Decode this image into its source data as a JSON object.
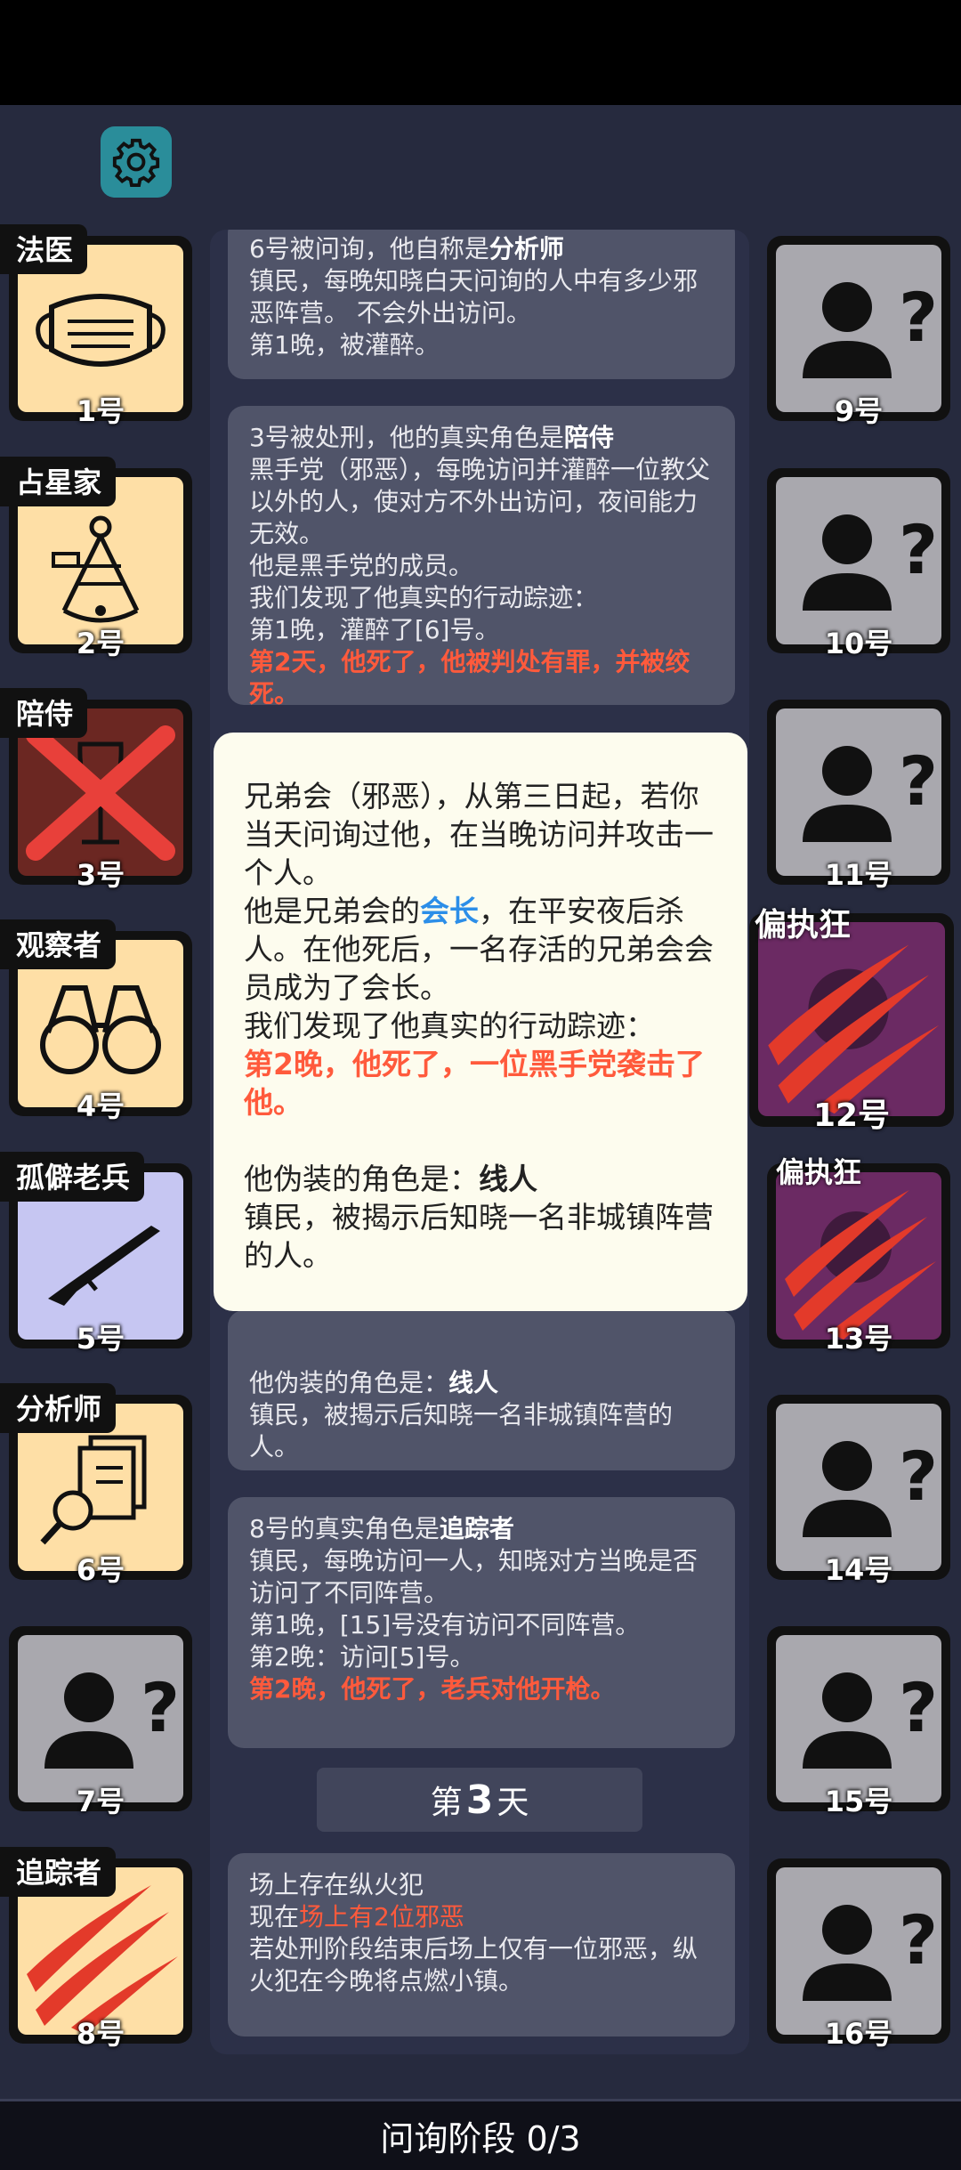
{
  "settings_icon": "gear-icon",
  "log": {
    "card1": {
      "l1": "6号被问询，他自称是",
      "l1b": "分析师",
      "l2": "镇民，每晚知晓白天问询的人中有多少邪恶阵营。 不会外出访问。",
      "l3": "第1晚，被灌醉。"
    },
    "card2": {
      "l1": "3号被处刑，他的真实角色是",
      "l1b": "陪侍",
      "l2": "黑手党（邪恶），每晚访问并灌醉一位教父以外的人，使对方不外出访问，夜间能力无效。",
      "l3": "他是黑手党的成员。",
      "l4": "我们发现了他真实的行动踪迹：",
      "l5": "第1晚，灌醉了[6]号。",
      "l6": "第2天，他死了，他被判处有罪，并被绞死。"
    },
    "card3": {
      "l1": "他伪装的角色是：",
      "l1b": "线人",
      "l2": "镇民，被揭示后知晓一名非城镇阵营的人。"
    },
    "card4": {
      "l1": "8号的真实角色是",
      "l1b": "追踪者",
      "l2": "镇民，每晚访问一人，知晓对方当晚是否访问了不同阵营。",
      "l3": "第1晚，[15]号没有访问不同阵营。",
      "l4": "第2晚：访问[5]号。",
      "l5": "第2晚，他死了，老兵对他开枪。"
    },
    "day": {
      "prefix": "第",
      "num": "3",
      "suffix": "天"
    },
    "card5": {
      "l1": "场上存在纵火犯",
      "l2a": "现在",
      "l2b": "场上有2位邪恶",
      "l3": "若处刑阶段结束后场上仅有一位邪恶，纵火犯在今晚将点燃小镇。"
    }
  },
  "popup": {
    "l1": "兄弟会（邪恶），从第三日起，若你当天问询过他，在当晚访问并攻击一个人。",
    "l2a": "他是兄弟会的",
    "l2b": "会长",
    "l2c": "，在平安夜后杀人。在他死后，一名存活的兄弟会会员成为了会长。",
    "l3": "我们发现了他真实的行动踪迹：",
    "l4": "第2晚，他死了，一位黑手党袭击了他。",
    "l5a": "他伪装的角色是：",
    "l5b": "线人",
    "l6": "镇民，被揭示后知晓一名非城镇阵营的人。"
  },
  "players_left": [
    {
      "num": "1号",
      "role": "法医",
      "icon": "mask-icon"
    },
    {
      "num": "2号",
      "role": "占星家",
      "icon": "sextant-icon"
    },
    {
      "num": "3号",
      "role": "陪侍",
      "icon": "wine-glass-crossed-icon"
    },
    {
      "num": "4号",
      "role": "观察者",
      "icon": "binoculars-icon"
    },
    {
      "num": "5号",
      "role": "孤僻老兵",
      "icon": "rifle-icon"
    },
    {
      "num": "6号",
      "role": "分析师",
      "icon": "documents-magnifier-icon"
    },
    {
      "num": "7号",
      "role": "",
      "icon": "unknown-person-icon"
    },
    {
      "num": "8号",
      "role": "追踪者",
      "icon": "claw-marks-icon"
    }
  ],
  "players_right": [
    {
      "num": "9号",
      "role": "",
      "icon": "unknown-person-icon"
    },
    {
      "num": "10号",
      "role": "",
      "icon": "unknown-person-icon"
    },
    {
      "num": "11号",
      "role": "",
      "icon": "unknown-person-icon"
    },
    {
      "num": "12号",
      "role": "偏执狂",
      "icon": "claw-marks-icon"
    },
    {
      "num": "13号",
      "role": "偏执狂",
      "icon": "claw-marks-icon"
    },
    {
      "num": "14号",
      "role": "",
      "icon": "unknown-person-icon"
    },
    {
      "num": "15号",
      "role": "",
      "icon": "unknown-person-icon"
    },
    {
      "num": "16号",
      "role": "",
      "icon": "unknown-person-icon"
    }
  ],
  "phase": "问询阶段 0/3",
  "colors": {
    "accent_red": "#ff5a3c",
    "link_blue": "#2c8ee8",
    "beige": "#fedfa6",
    "purple": "#6b2a63"
  }
}
